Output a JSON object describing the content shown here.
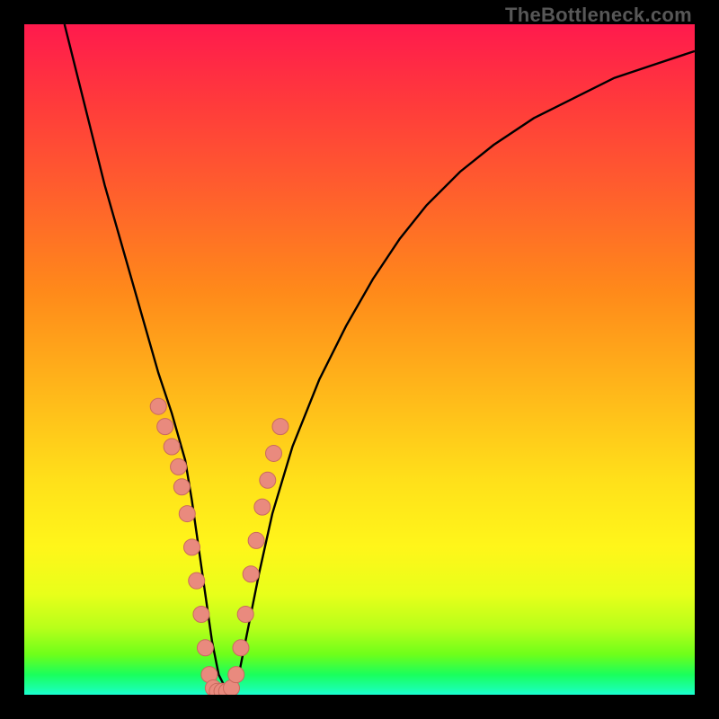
{
  "watermark_text": "TheBottleneck.com",
  "colors": {
    "curve": "#000000",
    "marker_fill": "#e98a7e",
    "marker_stroke": "#c96a5e",
    "frame": "#000000"
  },
  "chart_data": {
    "type": "line",
    "title": "",
    "xlabel": "",
    "ylabel": "",
    "xlim": [
      0,
      100
    ],
    "ylim": [
      0,
      100
    ],
    "series": [
      {
        "name": "curve",
        "x": [
          6,
          8,
          10,
          12,
          14,
          16,
          18,
          20,
          22,
          24,
          25,
          26,
          27,
          28,
          29,
          30,
          31,
          32,
          33,
          35,
          37,
          40,
          44,
          48,
          52,
          56,
          60,
          65,
          70,
          76,
          82,
          88,
          94,
          100
        ],
        "y": [
          100,
          92,
          84,
          76,
          69,
          62,
          55,
          48,
          42,
          35,
          29,
          22,
          15,
          8,
          3,
          1,
          1,
          3,
          8,
          18,
          27,
          37,
          47,
          55,
          62,
          68,
          73,
          78,
          82,
          86,
          89,
          92,
          94,
          96
        ]
      }
    ],
    "markers": {
      "name": "sample-points",
      "x": [
        20,
        21,
        22,
        23,
        23.5,
        24.3,
        25,
        25.7,
        26.4,
        27,
        27.6,
        28.2,
        28.8,
        29.5,
        30.2,
        30.9,
        31.6,
        32.3,
        33,
        33.8,
        34.6,
        35.5,
        36.3,
        37.2,
        38.2
      ],
      "y": [
        43,
        40,
        37,
        34,
        31,
        27,
        22,
        17,
        12,
        7,
        3,
        1,
        0.5,
        0.5,
        0.5,
        1,
        3,
        7,
        12,
        18,
        23,
        28,
        32,
        36,
        40
      ]
    }
  }
}
